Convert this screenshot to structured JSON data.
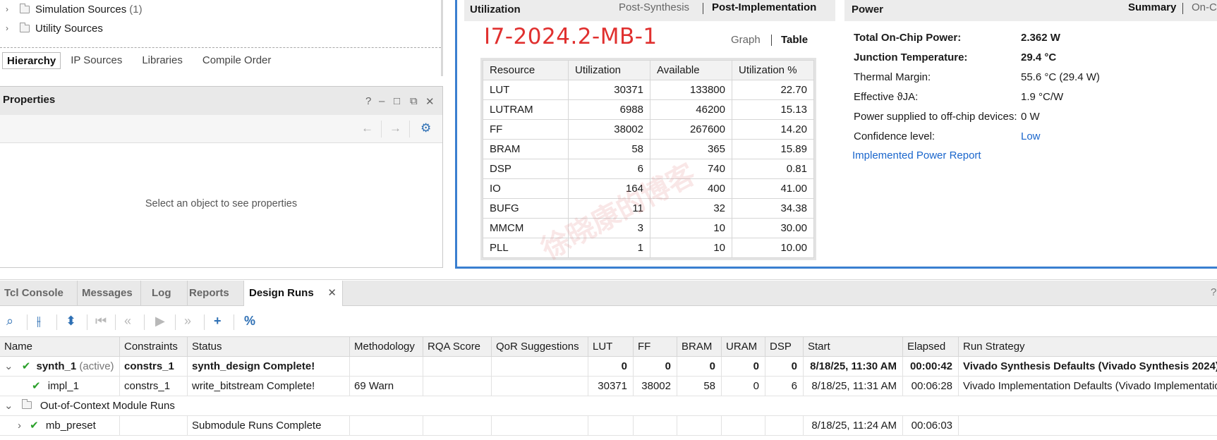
{
  "sources": {
    "items": [
      {
        "label": "Simulation Sources",
        "count": "(1)"
      },
      {
        "label": "Utility Sources",
        "count": ""
      }
    ],
    "tabs": [
      "Hierarchy",
      "IP Sources",
      "Libraries",
      "Compile Order"
    ]
  },
  "properties": {
    "title": "Properties",
    "empty_text": "Select an object to see properties"
  },
  "utilization": {
    "title": "Utilization",
    "tab_post_synthesis": "Post-Synthesis",
    "tab_post_implementation": "Post-Implementation",
    "device": "I7-2024.2-MB-1",
    "view_graph": "Graph",
    "view_table": "Table",
    "columns": [
      "Resource",
      "Utilization",
      "Available",
      "Utilization %"
    ],
    "rows": [
      {
        "resource": "LUT",
        "utilization": "30371",
        "available": "133800",
        "percent": "22.70"
      },
      {
        "resource": "LUTRAM",
        "utilization": "6988",
        "available": "46200",
        "percent": "15.13"
      },
      {
        "resource": "FF",
        "utilization": "38002",
        "available": "267600",
        "percent": "14.20"
      },
      {
        "resource": "BRAM",
        "utilization": "58",
        "available": "365",
        "percent": "15.89"
      },
      {
        "resource": "DSP",
        "utilization": "6",
        "available": "740",
        "percent": "0.81"
      },
      {
        "resource": "IO",
        "utilization": "164",
        "available": "400",
        "percent": "41.00"
      },
      {
        "resource": "BUFG",
        "utilization": "11",
        "available": "32",
        "percent": "34.38"
      },
      {
        "resource": "MMCM",
        "utilization": "3",
        "available": "10",
        "percent": "30.00"
      },
      {
        "resource": "PLL",
        "utilization": "1",
        "available": "10",
        "percent": "10.00"
      }
    ]
  },
  "power": {
    "title": "Power",
    "tab_summary": "Summary",
    "tab_onchip": "On-C",
    "rows": [
      {
        "label": "Total On-Chip Power:",
        "value": "2.362 W"
      },
      {
        "label": "Junction Temperature:",
        "value": "29.4 °C"
      },
      {
        "label": "Thermal Margin:",
        "value": "55.6 °C (29.4 W)"
      },
      {
        "label": "Effective ϑJA:",
        "value": "1.9 °C/W"
      },
      {
        "label": "Power supplied to off-chip devices:",
        "value": "0 W"
      },
      {
        "label": "Confidence level:",
        "value": "Low"
      }
    ],
    "report_link": "Implemented Power Report"
  },
  "bottom": {
    "tabs": [
      "Tcl Console",
      "Messages",
      "Log",
      "Reports",
      "Design Runs"
    ],
    "help": "?",
    "columns": [
      "Name",
      "Constraints",
      "Status",
      "Methodology",
      "RQA Score",
      "QoR Suggestions",
      "LUT",
      "FF",
      "BRAM",
      "URAM",
      "DSP",
      "Start",
      "Elapsed",
      "Run Strategy"
    ],
    "runs": [
      {
        "name": "synth_1",
        "active": "(active)",
        "constraints": "constrs_1",
        "status": "synth_design Complete!",
        "methodology": "",
        "lut": "0",
        "ff": "0",
        "bram": "0",
        "uram": "0",
        "dsp": "0",
        "start": "8/18/25, 11:30 AM",
        "elapsed": "00:00:42",
        "strategy": "Vivado Synthesis Defaults (Vivado Synthesis 2024)"
      },
      {
        "name": "impl_1",
        "constraints": "constrs_1",
        "status": "write_bitstream Complete!",
        "methodology": "69 Warn",
        "lut": "30371",
        "ff": "38002",
        "bram": "58",
        "uram": "0",
        "dsp": "6",
        "start": "8/18/25, 11:31 AM",
        "elapsed": "00:06:28",
        "strategy": "Vivado Implementation Defaults (Vivado Implementation"
      },
      {
        "name": "Out-of-Context Module Runs"
      },
      {
        "name": "mb_preset",
        "status": "Submodule Runs Complete",
        "start": "8/18/25, 11:24 AM",
        "elapsed": "00:06:03"
      }
    ]
  },
  "colors": {
    "accent_blue": "#3a7fd0",
    "device_red": "#e0302f",
    "check_green": "#2aa02a",
    "link_blue": "#1a66cc"
  }
}
